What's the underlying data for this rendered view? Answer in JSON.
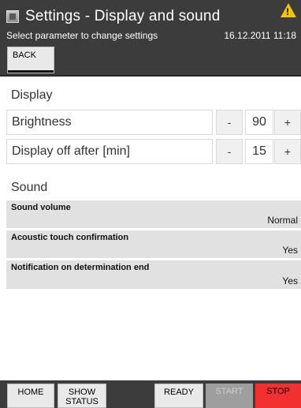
{
  "header": {
    "title": "Settings - Display and sound",
    "subtitle": "Select parameter to change settings",
    "datetime": "16.12.2011 11:18",
    "warning_icon": "warning-triangle",
    "warning_mark": "!"
  },
  "toolbar": {
    "back_label": "BACK"
  },
  "display": {
    "section_title": "Display",
    "brightness": {
      "label": "Brightness",
      "value": "90",
      "minus": "-",
      "plus": "+"
    },
    "display_off": {
      "label": "Display off after [min]",
      "value": "15",
      "minus": "-",
      "plus": "+"
    }
  },
  "sound": {
    "section_title": "Sound",
    "items": [
      {
        "label": "Sound volume",
        "value": "Normal"
      },
      {
        "label": "Acoustic touch confirmation",
        "value": "Yes"
      },
      {
        "label": "Notification on determination end",
        "value": "Yes"
      }
    ]
  },
  "footer": {
    "home": "HOME",
    "show_status": "SHOW STATUS",
    "ready": "READY",
    "start": "START",
    "stop": "STOP"
  },
  "colors": {
    "header_bg": "#3c3c3c",
    "stop": "#f23030",
    "warning": "#f2c500",
    "row_bg": "#e1e1e1"
  }
}
